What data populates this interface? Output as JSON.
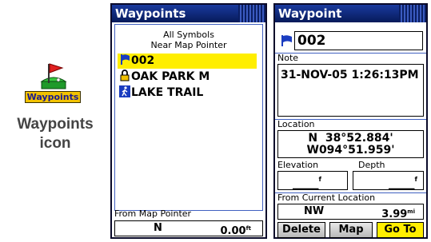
{
  "icon_figure": {
    "icon_label": "Waypoints",
    "caption_line1": "Waypoints",
    "caption_line2": "icon"
  },
  "list_screen": {
    "title": "Waypoints",
    "filter_line1": "All Symbols",
    "filter_line2": "Near Map Pointer",
    "items": [
      {
        "icon": "blue-flag-icon",
        "name": "002",
        "selected": true
      },
      {
        "icon": "lock-icon",
        "name": "OAK PARK M",
        "selected": false
      },
      {
        "icon": "hiker-icon",
        "name": "LAKE TRAIL",
        "selected": false
      }
    ],
    "footer_label": "From Map Pointer",
    "footer_bearing": "N",
    "footer_distance": "0.00",
    "footer_distance_unit": "ft"
  },
  "detail_screen": {
    "title": "Waypoint",
    "name": "002",
    "note_label": "Note",
    "note_value": "31-NOV-05 1:26:13PM",
    "location_label": "Location",
    "location_lat": "N  38°52.884'",
    "location_lon": "W094°51.959'",
    "elevation_label": "Elevation",
    "elevation_value": "_____",
    "elevation_unit": "f",
    "depth_label": "Depth",
    "depth_value": "_____",
    "depth_unit": "f",
    "from_current_label": "From Current Location",
    "bearing": "NW",
    "distance": "3.99",
    "distance_unit": "mi",
    "buttons": {
      "delete": "Delete",
      "map": "Map",
      "goto": "Go To"
    }
  },
  "colors": {
    "titlebar": "#0e2a80",
    "highlight": "#ffee00",
    "flag": "#1a3cc0"
  }
}
